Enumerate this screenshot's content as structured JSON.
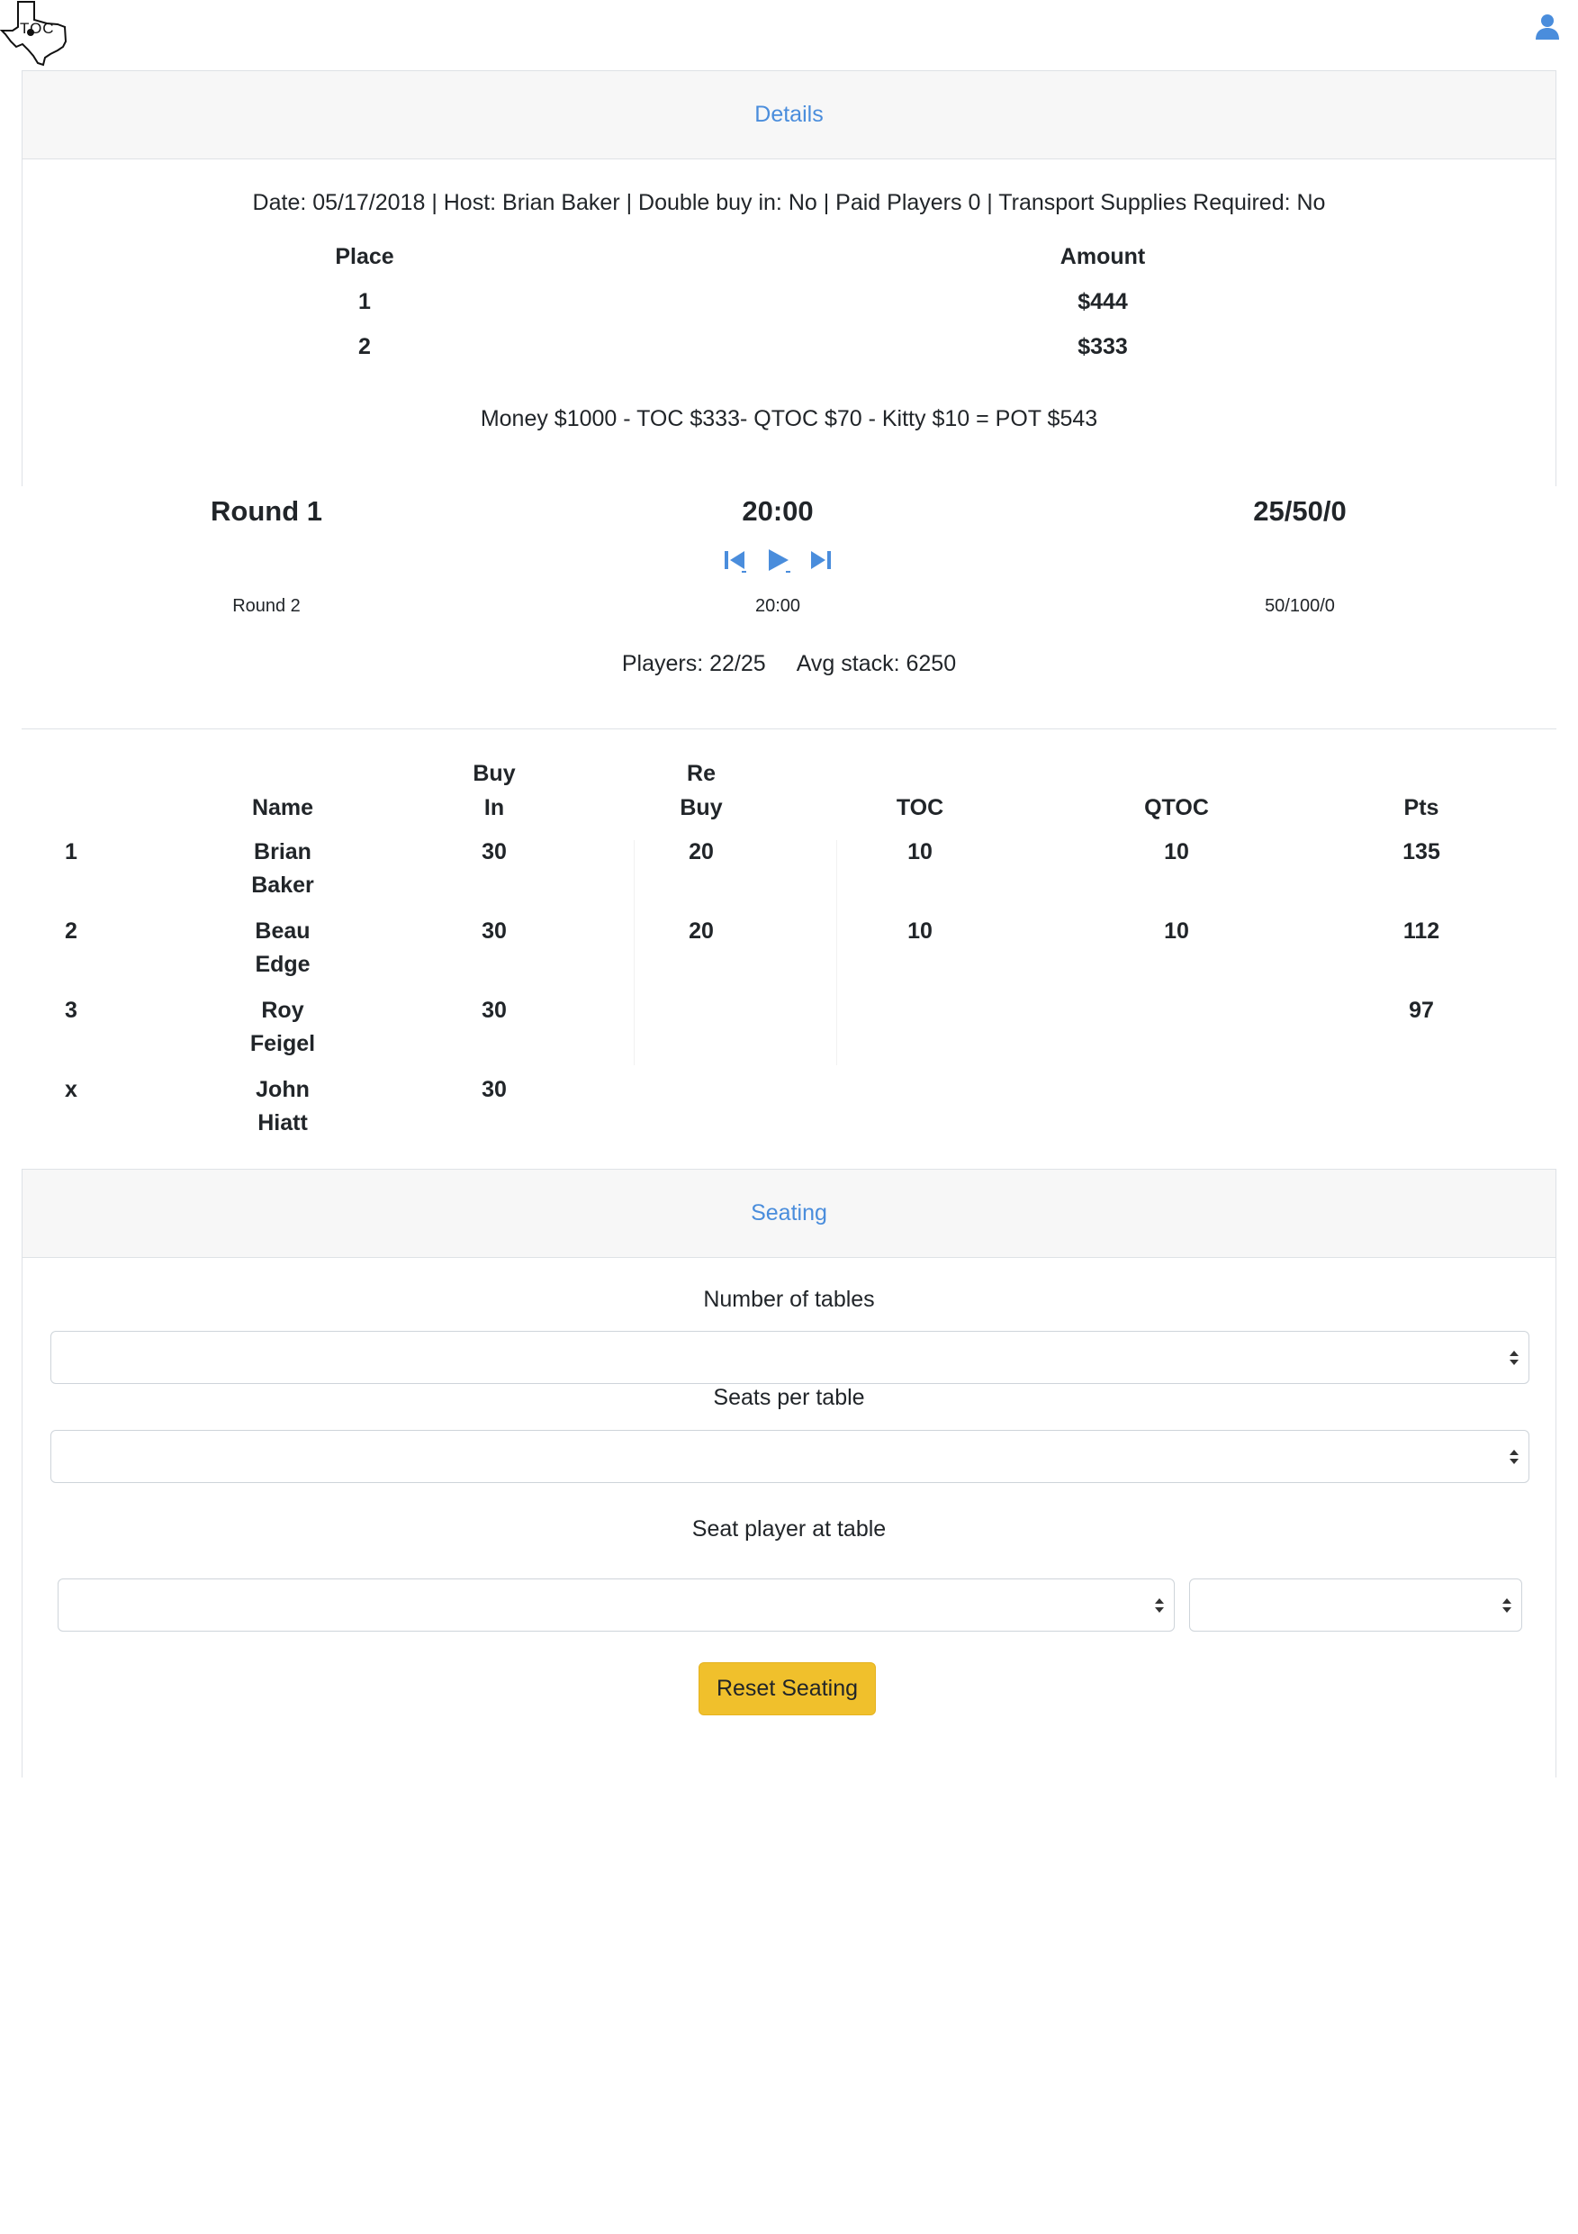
{
  "header": {
    "logo_icon": "texas-map-icon",
    "logo_text": "TOC",
    "user_icon": "user-icon",
    "accent_color": "#4a8ddc"
  },
  "details": {
    "header_label": "Details",
    "info_line": "Date: 05/17/2018 | Host: Brian Baker | Double buy in: No | Paid Players 0 | Transport Supplies Required: No",
    "payout_headers": [
      "Place",
      "Amount"
    ],
    "payouts": [
      {
        "place": "1",
        "amount": "$444"
      },
      {
        "place": "2",
        "amount": "$333"
      }
    ],
    "money_line": "Money $1000 - TOC $333- QTOC $70 - Kitty $10 = POT $543"
  },
  "clock": {
    "current_round": "Round 1",
    "current_time": "20:00",
    "current_blinds": "25/50/0",
    "next_round": "Round 2",
    "next_time": "20:00",
    "next_blinds": "50/100/0",
    "players": "Players: 22/25",
    "avg_stack": "Avg stack: 6250",
    "controls": [
      "skip-back-icon",
      "play-icon",
      "skip-forward-icon"
    ]
  },
  "results": {
    "headers": {
      "name": "Name",
      "buy_in_1": "Buy",
      "buy_in_2": "In",
      "rebuy_1": "Re",
      "rebuy_2": "Buy",
      "toc": "TOC",
      "qtoc": "QTOC",
      "pts": "Pts"
    },
    "rows": [
      {
        "place": "1",
        "first": "Brian",
        "last": "Baker",
        "buy_in": "30",
        "rebuy": "20",
        "toc": "10",
        "qtoc": "10",
        "pts": "135"
      },
      {
        "place": "2",
        "first": "Beau",
        "last": "Edge",
        "buy_in": "30",
        "rebuy": "20",
        "toc": "10",
        "qtoc": "10",
        "pts": "112"
      },
      {
        "place": "3",
        "first": "Roy",
        "last": "Feigel",
        "buy_in": "30",
        "rebuy": "",
        "toc": "",
        "qtoc": "",
        "pts": "97"
      },
      {
        "place": "x",
        "first": "John",
        "last": "Hiatt",
        "buy_in": "30",
        "rebuy": "",
        "toc": "",
        "qtoc": "",
        "pts": ""
      }
    ]
  },
  "seating": {
    "header_label": "Seating",
    "num_tables_label": "Number of tables",
    "num_tables_value": "",
    "seats_per_table_label": "Seats per table",
    "seats_per_table_value": "",
    "seat_player_label": "Seat player at table",
    "player_select_value": "",
    "table_select_value": "",
    "reset_label": "Reset Seating",
    "button_color": "#f0c02c"
  }
}
